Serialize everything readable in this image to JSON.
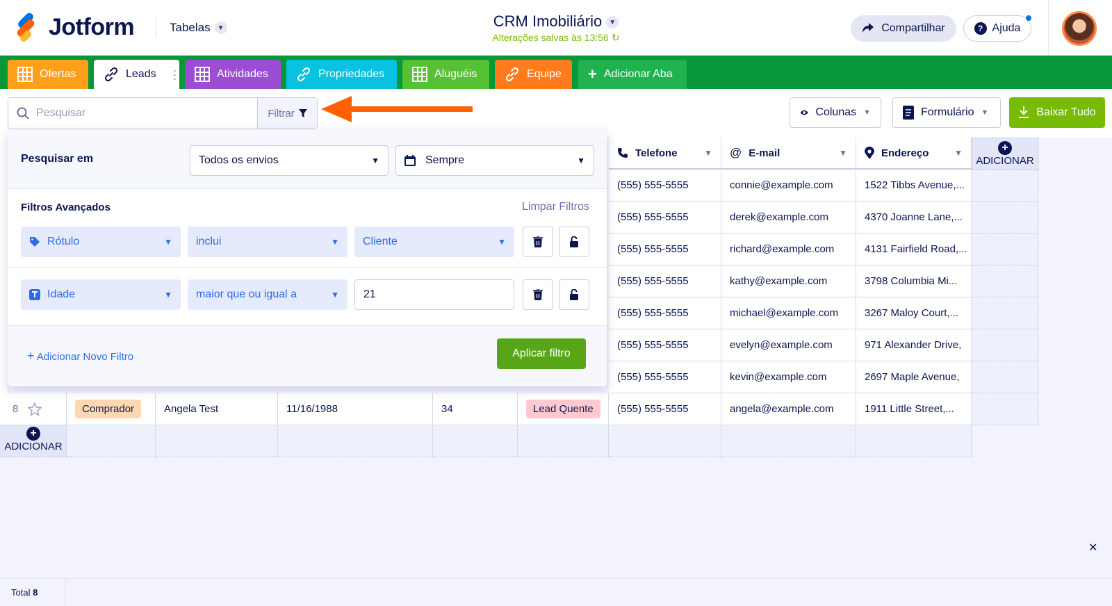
{
  "brand": {
    "name": "Jotform",
    "colors": {
      "blue": "#0075e3",
      "orange": "#ff6100",
      "yellow": "#ffb629",
      "green": "#07983a",
      "navy": "#0a1551"
    }
  },
  "header": {
    "tables_label": "Tabelas",
    "title": "CRM Imobiliário",
    "saved_status": "Alterações salvas às 13:56",
    "share_label": "Compartilhar",
    "help_label": "Ajuda"
  },
  "tabs": [
    {
      "label": "Ofertas",
      "icon": "table-icon",
      "color": "#ff9f1a"
    },
    {
      "label": "Leads",
      "icon": "link-icon",
      "color": "#ffffff",
      "active": true
    },
    {
      "label": "Atividades",
      "icon": "table-icon",
      "color": "#9c4dd3"
    },
    {
      "label": "Propriedades",
      "icon": "link-icon",
      "color": "#09c2e0"
    },
    {
      "label": "Aluguéis",
      "icon": "table-icon",
      "color": "#56c134"
    },
    {
      "label": "Equipe",
      "icon": "link-icon",
      "color": "#ff7b1c"
    },
    {
      "label": "Adicionar Aba",
      "icon": "plus-icon",
      "color": "#1fb24e"
    }
  ],
  "toolbar": {
    "search_placeholder": "Pesquisar",
    "filter_label": "Filtrar",
    "columns_label": "Colunas",
    "form_label": "Formulário",
    "download_label": "Baixar Tudo"
  },
  "filter_panel": {
    "search_in_label": "Pesquisar em",
    "search_in_value": "Todos os envios",
    "date_value": "Sempre",
    "advanced_label": "Filtros Avançados",
    "clear_label": "Limpar Filtros",
    "filters": [
      {
        "field": "Rótulo",
        "operator": "inclui",
        "value": "Cliente"
      },
      {
        "field": "Idade",
        "operator": "maior que ou igual a",
        "value": "21"
      }
    ],
    "add_filter_label": "Adicionar Novo Filtro",
    "apply_label": "Aplicar filtro"
  },
  "table": {
    "columns": [
      {
        "label": "Telefone",
        "icon": "phone-icon"
      },
      {
        "label": "E-mail",
        "icon": "at-icon"
      },
      {
        "label": "Endereço",
        "icon": "location-pin-icon"
      }
    ],
    "add_column_label": "ADICIONAR",
    "add_row_label": "ADICIONAR",
    "rows": [
      {
        "phone": "(555) 555-5555",
        "email": "connie@example.com",
        "address": "1522 Tibbs Avenue,..."
      },
      {
        "phone": "(555) 555-5555",
        "email": "derek@example.com",
        "address": "4370 Joanne Lane,..."
      },
      {
        "phone": "(555) 555-5555",
        "email": "richard@example.com",
        "address": "4131 Fairfield Road,..."
      },
      {
        "phone": "(555) 555-5555",
        "email": "kathy@example.com",
        "address": "3798 Columbia Mi..."
      },
      {
        "phone": "(555) 555-5555",
        "email": "michael@example.com",
        "address": "3267 Maloy Court,..."
      },
      {
        "phone": "(555) 555-5555",
        "email": "evelyn@example.com",
        "address": "971 Alexander Drive,"
      },
      {
        "phone": "(555) 555-5555",
        "email": "kevin@example.com",
        "address": "2697 Maple Avenue,"
      }
    ],
    "last_row": {
      "number": "8",
      "label": "Comprador",
      "name": "Angela Test",
      "birth": "11/16/1988",
      "age": "34",
      "status": "Lead Quente",
      "phone": "(555) 555-5555",
      "email": "angela@example.com",
      "address": "1911 Little Street,..."
    }
  },
  "footer": {
    "total_label": "Total",
    "total_value": "8"
  }
}
